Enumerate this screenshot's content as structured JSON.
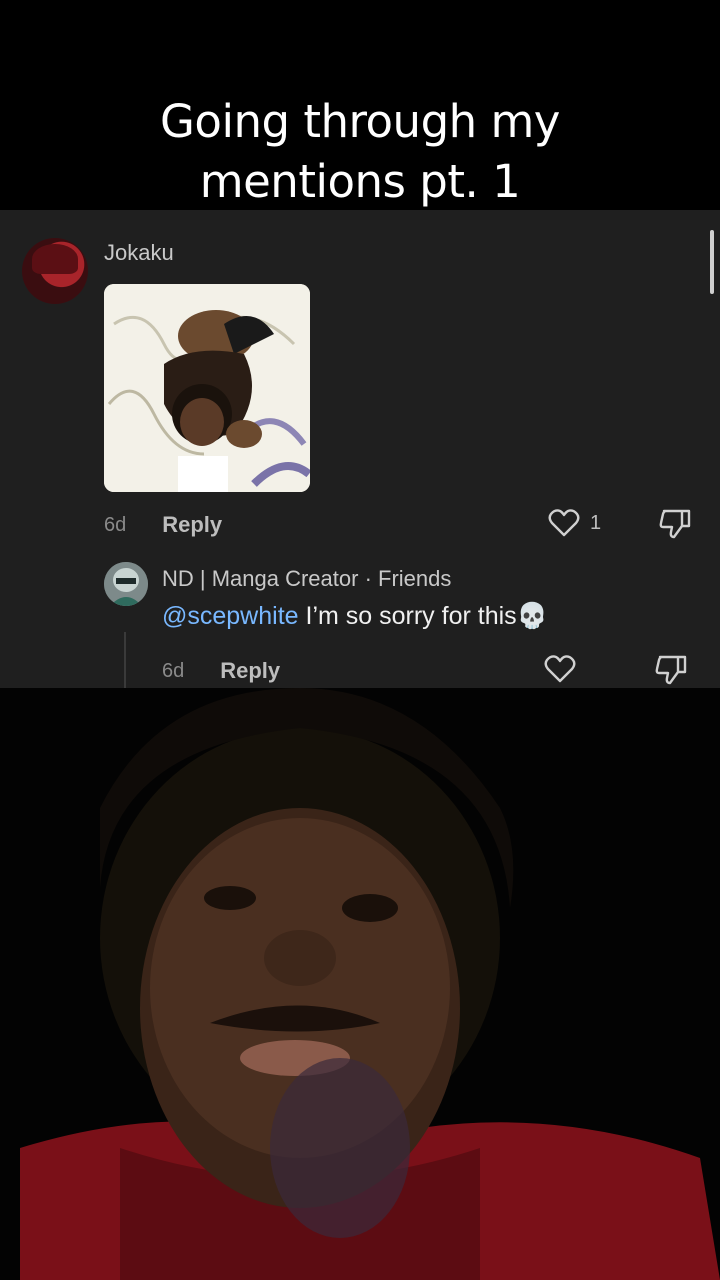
{
  "overlay": {
    "title_line1": "Going through my",
    "title_line2": "mentions pt. 1"
  },
  "comment1": {
    "username": "Jokaku",
    "attachment_icon": "sticker-image",
    "time": "6d",
    "reply_label": "Reply",
    "like_count": "1"
  },
  "comment2": {
    "username": "ND | Manga Creator · Friends",
    "mention": "@scepwhite",
    "text": " I’m so sorry for this",
    "emoji": "💀",
    "time": "6d",
    "reply_label": "Reply"
  },
  "icons": {
    "like": "heart-icon",
    "dislike": "thumbs-down-icon"
  },
  "colors": {
    "panel_bg": "#1f1f1f",
    "mention": "#79b8ff"
  }
}
